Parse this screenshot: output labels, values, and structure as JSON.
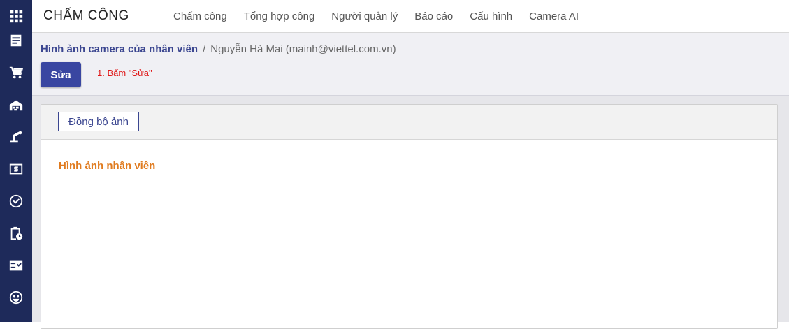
{
  "app": {
    "title": "CHẤM CÔNG"
  },
  "menu": [
    "Chấm công",
    "Tổng hợp công",
    "Người quản lý",
    "Báo cáo",
    "Cấu hình",
    "Camera AI"
  ],
  "rail_icons": [
    "apps-grid-icon",
    "form-icon",
    "cart-icon",
    "inventory-icon",
    "manufacturing-icon",
    "payroll-icon",
    "check-circle-icon",
    "clipboard-clock-icon",
    "checklist-icon",
    "smiley-icon"
  ],
  "breadcrumb": {
    "parent": "Hình ảnh camera của nhân viên",
    "separator": "/",
    "current": "Nguyễn Hà Mai (mainh@viettel.com.vn)"
  },
  "toolbar": {
    "edit_label": "Sửa",
    "annotation": "1. Bấm \"Sửa\""
  },
  "sheet": {
    "sync_label": "Đồng bộ ảnh",
    "section_title": "Hình ảnh nhân viên"
  },
  "colors": {
    "rail": "#1e2a5a",
    "primary": "#3946a1",
    "section_title": "#e07b1f",
    "annotation": "#e01818"
  }
}
